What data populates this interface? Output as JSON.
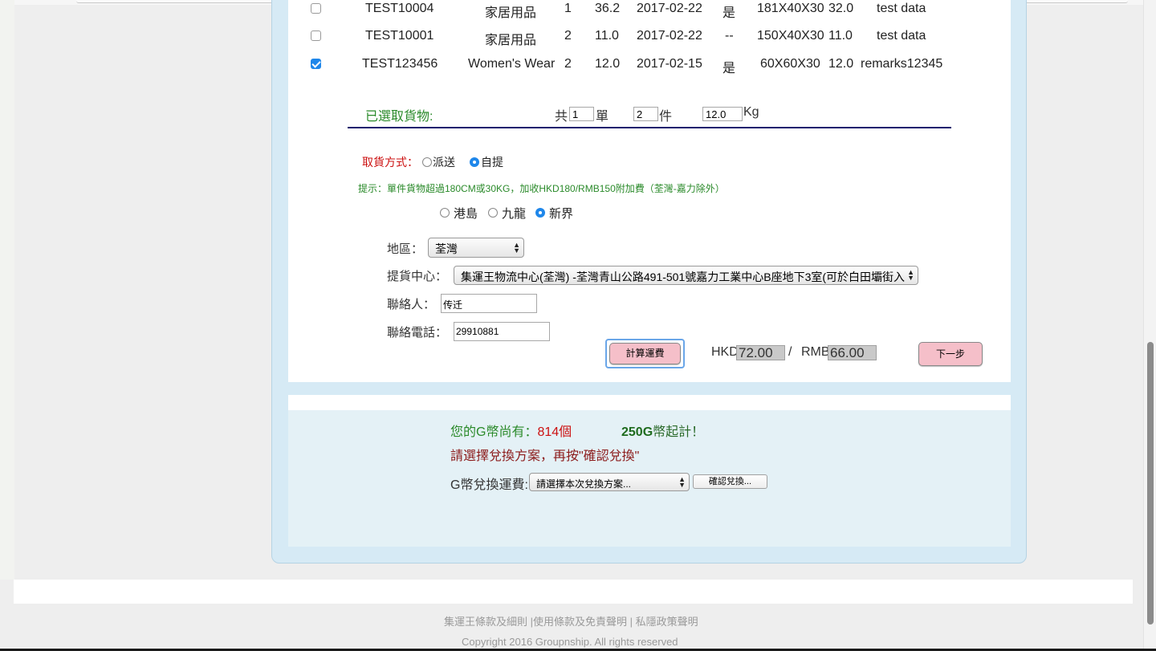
{
  "table": {
    "rows": [
      {
        "checked": false,
        "id": "TEST10004",
        "category": "家居用品",
        "qty": "1",
        "weight": "36.2",
        "date": "2017-02-22",
        "flag": "是",
        "dims": "181X40X30",
        "charge_weight": "32.0",
        "remarks": "test data"
      },
      {
        "checked": false,
        "id": "TEST10001",
        "category": "家居用品",
        "qty": "2",
        "weight": "11.0",
        "date": "2017-02-22",
        "flag": "--",
        "dims": "150X40X30",
        "charge_weight": "11.0",
        "remarks": "test data"
      },
      {
        "checked": true,
        "id": "TEST123456",
        "category": "Women's Wear",
        "qty": "2",
        "weight": "12.0",
        "date": "2017-02-15",
        "flag": "是",
        "dims": "60X60X30",
        "charge_weight": "12.0",
        "remarks": "remarks12345"
      }
    ]
  },
  "summary": {
    "label": "已選取貨物:",
    "total_prefix": "共",
    "orders_value": "1",
    "orders_unit": "單",
    "pieces_value": "2",
    "pieces_unit": "件",
    "weight_value": "12.0",
    "weight_unit": "Kg"
  },
  "pickup": {
    "label": "取貨方式：",
    "option_delivery": "派送",
    "option_self": "自提",
    "selected": "自提",
    "hint": "提示：單件貨物超過180CM或30KG，加收HKD180/RMB150附加費（荃灣-嘉力除外）",
    "region_hk": "港島",
    "region_kln": "九龍",
    "region_nt": "新界",
    "region_selected": "新界"
  },
  "form": {
    "district_label": "地區：",
    "district_value": "荃灣",
    "center_label": "提貨中心：",
    "center_value": "集運王物流中心(荃灣) -荃灣青山公路491-501號嘉力工業中心B座地下3室(可於白田壩街入",
    "contact_label": "聯絡人：",
    "contact_value": "传迁",
    "phone_label": "聯絡電話：",
    "phone_value": "29910881"
  },
  "calc": {
    "button": "計算運費",
    "hkd_label": "HKD",
    "hkd_value": "72.00",
    "separator": "/",
    "rmb_label": "RMB",
    "rmb_value": "66.00",
    "next_button": "下一步"
  },
  "gcoin": {
    "balance_prefix": "您的G幣尚有：",
    "balance_value": "814個",
    "minimum_bold": "250G",
    "minimum_rest": "幣起計！",
    "instruction": "請選擇兌換方案，再按\"確認兌換\"",
    "exchange_label": "G幣兌換運費:",
    "exchange_placeholder": "請選擇本次兌換方案...",
    "confirm_button": "確認兌換..."
  },
  "footer": {
    "link_terms": "集運王條款及細則",
    "link_usage": "使用條款及免責聲明",
    "link_privacy": "私隱政策聲明",
    "sep1": " |",
    "sep2": " | ",
    "copyright": "Copyright 2016 Groupnship. All rights reserved"
  },
  "colors": {
    "accent_blue": "#1f87ea",
    "red_label": "#cc1111",
    "green_text": "#2a8a2a",
    "dark_red_text": "#8b1a1a",
    "pink_button": "#f5bfc9",
    "navy_rule": "#1a1a6e"
  }
}
